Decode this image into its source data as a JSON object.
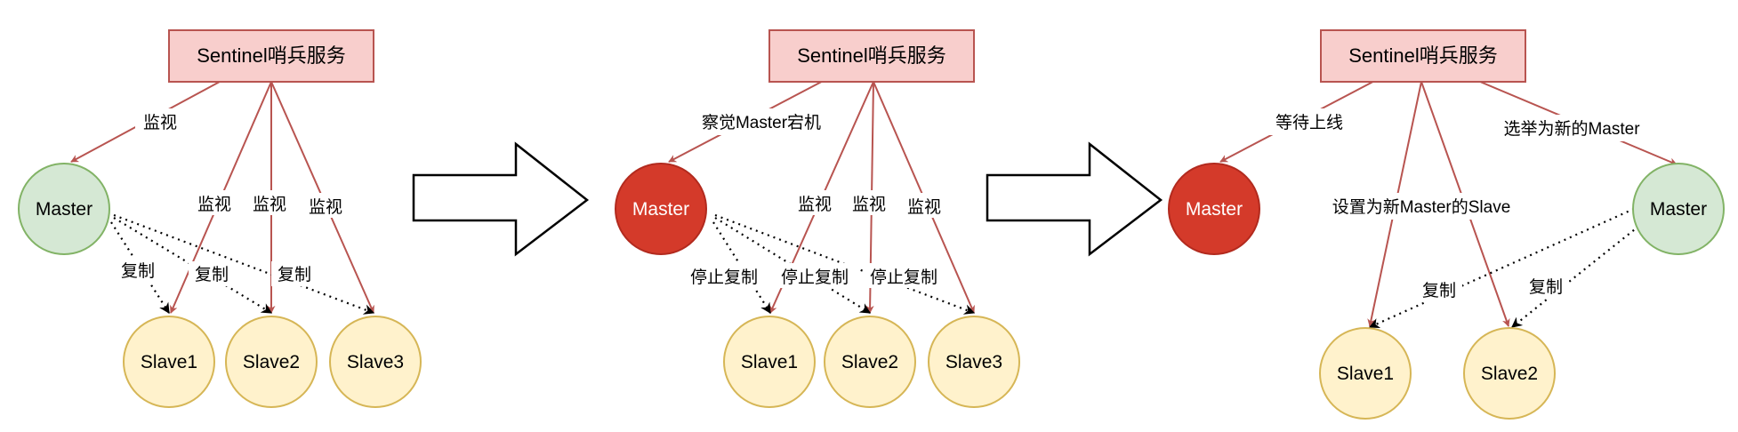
{
  "colors": {
    "sentinel_fill": "#f8cecc",
    "sentinel_stroke": "#b85450",
    "master_ok_fill": "#d5e8d4",
    "master_ok_stroke": "#82b366",
    "master_down_fill": "#d43a2a",
    "master_down_stroke": "#b22a1e",
    "slave_fill": "#fff2cc",
    "slave_stroke": "#d6b656",
    "monitor_edge": "#b85450",
    "replicate_edge": "#000000"
  },
  "panels": [
    {
      "sentinel": "Sentinel哨兵服务",
      "master": "Master",
      "master_state": "ok",
      "master_edge_label": "监视",
      "slaves": [
        "Slave1",
        "Slave2",
        "Slave3"
      ],
      "slave_monitor_labels": [
        "监视",
        "监视",
        "监视"
      ],
      "replicate_labels": [
        "复制",
        "复制",
        "复制"
      ]
    },
    {
      "sentinel": "Sentinel哨兵服务",
      "master": "Master",
      "master_state": "down",
      "master_edge_label": "察觉Master宕机",
      "slaves": [
        "Slave1",
        "Slave2",
        "Slave3"
      ],
      "slave_monitor_labels": [
        "监视",
        "监视",
        "监视"
      ],
      "replicate_labels": [
        "停止复制",
        "停止复制",
        "停止复制"
      ]
    },
    {
      "sentinel": "Sentinel哨兵服务",
      "old_master": "Master",
      "old_master_state": "down",
      "old_master_edge_label": "等待上线",
      "new_master": "Master",
      "new_master_state": "ok",
      "new_master_edge_label": "选举为新的Master",
      "slave_reconfig_label": "设置为新Master的Slave",
      "slaves": [
        "Slave1",
        "Slave2"
      ],
      "replicate_labels": [
        "复制",
        "复制"
      ]
    }
  ]
}
